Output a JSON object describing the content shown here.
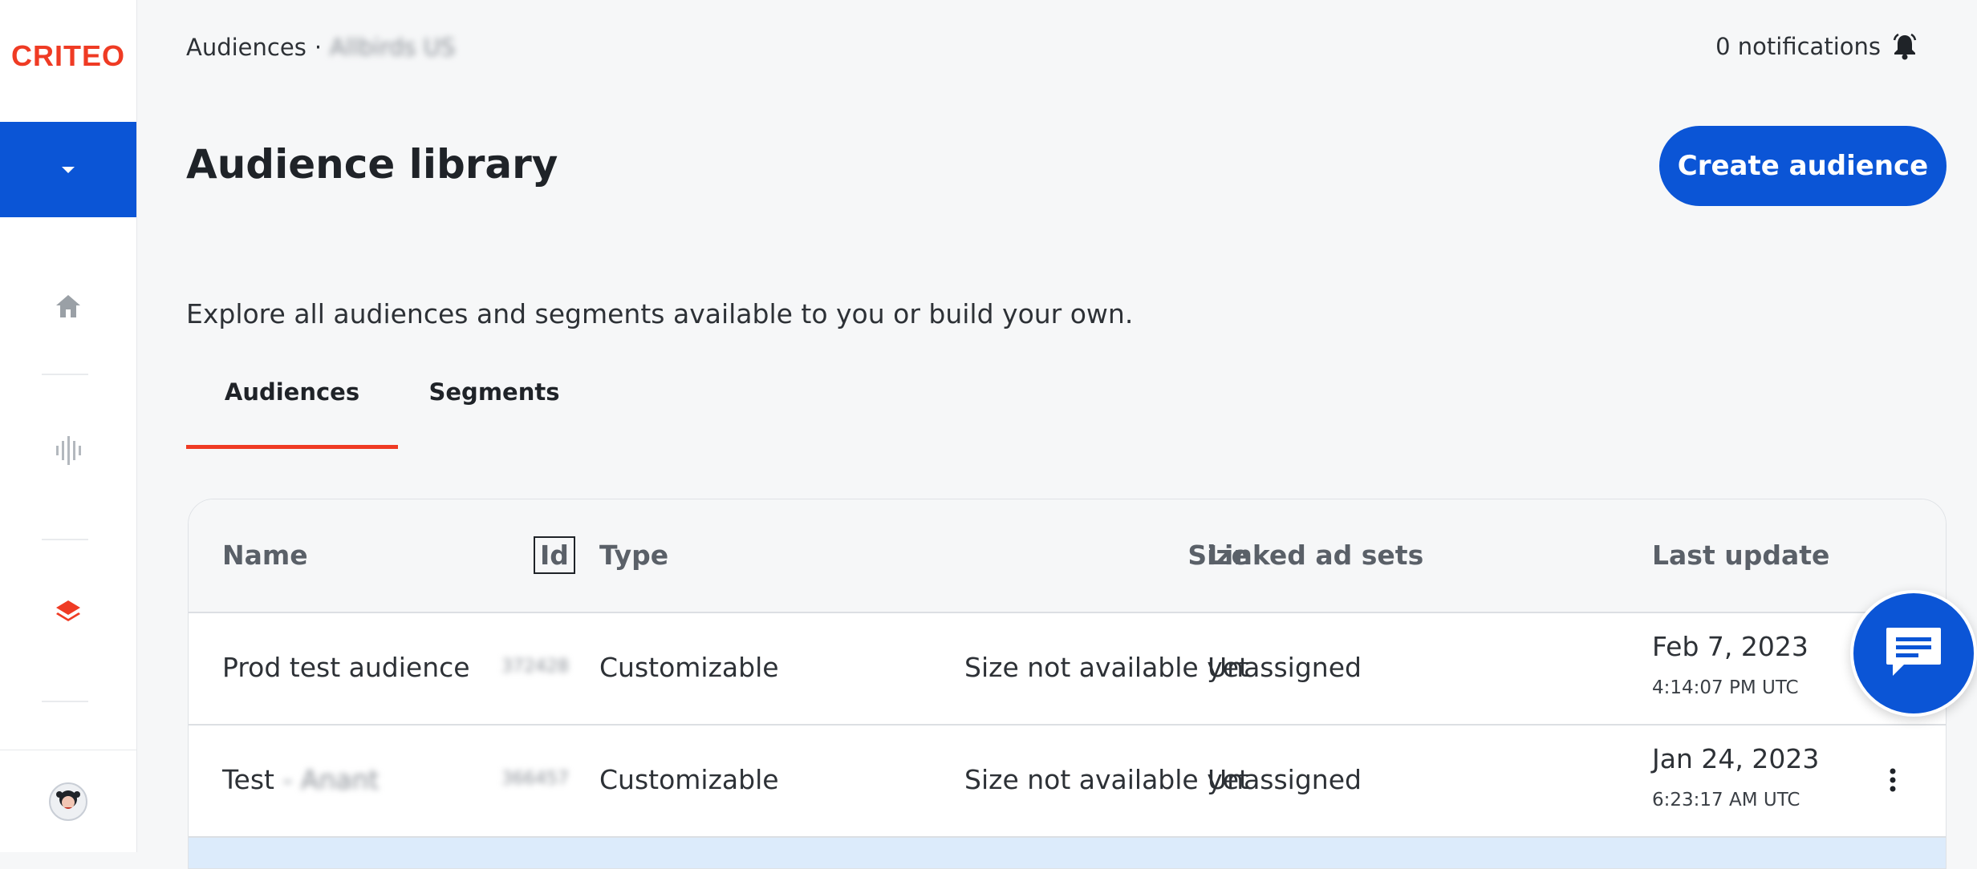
{
  "app": {
    "logo_text": "CRITEO",
    "brand_color": "#ef3b24",
    "accent_color": "#0b55d6"
  },
  "sidebar": {
    "nav": [
      {
        "icon": "home-icon"
      },
      {
        "icon": "analytics-icon"
      },
      {
        "icon": "layers-icon",
        "active": true
      }
    ]
  },
  "topbar": {
    "breadcrumb_root": "Audiences",
    "breadcrumb_sep": "·",
    "breadcrumb_account": "Allbirds US",
    "notifications_label": "0 notifications"
  },
  "header": {
    "title": "Audience library",
    "create_button": "Create audience",
    "subtitle": "Explore all audiences and segments available to you or build your own."
  },
  "tabs": [
    {
      "label": "Audiences",
      "active": true
    },
    {
      "label": "Segments",
      "active": false
    }
  ],
  "table": {
    "columns": {
      "name": "Name",
      "id": "Id",
      "type": "Type",
      "size": "Size",
      "linked": "Linked ad sets",
      "updated": "Last update"
    },
    "rows": [
      {
        "name": "Prod test audience",
        "name_suffix": "",
        "id": "372428",
        "type": "Customizable",
        "size": "Size not available yet",
        "linked": "Unassigned",
        "date": "Feb 7, 2023",
        "time": "4:14:07 PM UTC"
      },
      {
        "name": "Test",
        "name_suffix": "- Anant",
        "id": "366457",
        "type": "Customizable",
        "size": "Size not available yet",
        "linked": "Unassigned",
        "date": "Jan 24, 2023",
        "time": "6:23:17 AM UTC"
      }
    ]
  }
}
